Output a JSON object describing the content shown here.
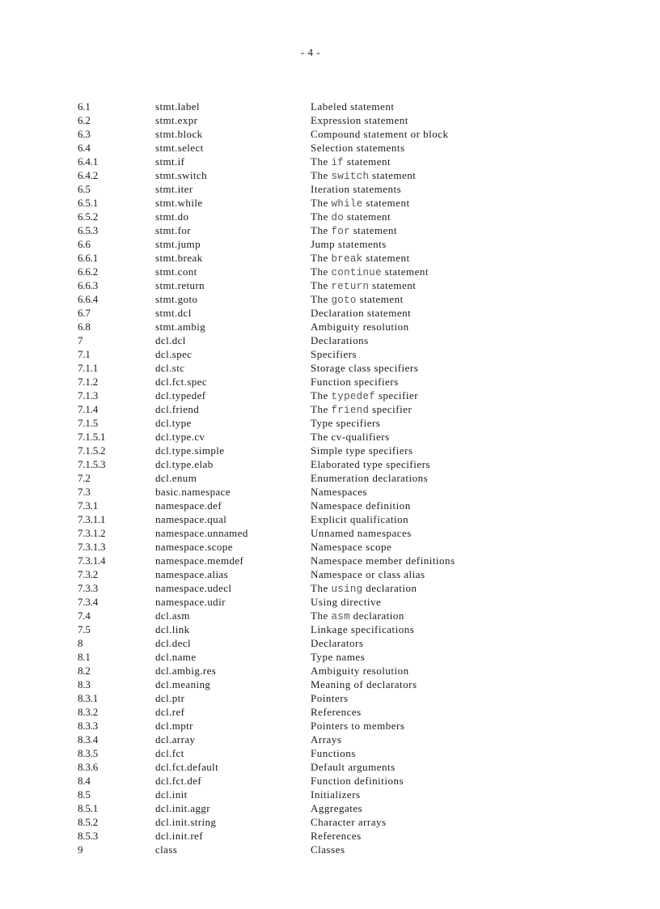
{
  "page": {
    "number": "- 4 -"
  },
  "entries": [
    {
      "num": "6.1",
      "label": "stmt.label",
      "title": [
        "Labeled statement"
      ]
    },
    {
      "num": "6.2",
      "label": "stmt.expr",
      "title": [
        "Expression statement"
      ]
    },
    {
      "num": "6.3",
      "label": "stmt.block",
      "title": [
        "Compound statement or block"
      ]
    },
    {
      "num": "6.4",
      "label": "stmt.select",
      "title": [
        "Selection statements"
      ]
    },
    {
      "num": "6.4.1",
      "label": "stmt.if",
      "title": [
        "The ",
        "if",
        " statement"
      ]
    },
    {
      "num": "6.4.2",
      "label": "stmt.switch",
      "title": [
        "The ",
        "switch",
        " statement"
      ]
    },
    {
      "num": "6.5",
      "label": "stmt.iter",
      "title": [
        "Iteration statements"
      ]
    },
    {
      "num": "6.5.1",
      "label": "stmt.while",
      "title": [
        "The ",
        "while",
        " statement"
      ]
    },
    {
      "num": "6.5.2",
      "label": "stmt.do",
      "title": [
        "The ",
        "do",
        " statement"
      ]
    },
    {
      "num": "6.5.3",
      "label": "stmt.for",
      "title": [
        "The ",
        "for",
        " statement"
      ]
    },
    {
      "num": "6.6",
      "label": "stmt.jump",
      "title": [
        "Jump statements"
      ]
    },
    {
      "num": "6.6.1",
      "label": "stmt.break",
      "title": [
        "The ",
        "break",
        " statement"
      ]
    },
    {
      "num": "6.6.2",
      "label": "stmt.cont",
      "title": [
        "The ",
        "continue",
        " statement"
      ]
    },
    {
      "num": "6.6.3",
      "label": "stmt.return",
      "title": [
        "The ",
        "return",
        " statement"
      ]
    },
    {
      "num": "6.6.4",
      "label": "stmt.goto",
      "title": [
        "The ",
        "goto",
        " statement"
      ]
    },
    {
      "num": "6.7",
      "label": "stmt.dcl",
      "title": [
        "Declaration statement"
      ]
    },
    {
      "num": "6.8",
      "label": "stmt.ambig",
      "title": [
        "Ambiguity resolution"
      ]
    },
    {
      "num": "7",
      "label": "dcl.dcl",
      "title": [
        "Declarations"
      ]
    },
    {
      "num": "7.1",
      "label": "dcl.spec",
      "title": [
        "Specifiers"
      ]
    },
    {
      "num": "7.1.1",
      "label": "dcl.stc",
      "title": [
        "Storage class specifiers"
      ]
    },
    {
      "num": "7.1.2",
      "label": "dcl.fct.spec",
      "title": [
        "Function specifiers"
      ]
    },
    {
      "num": "7.1.3",
      "label": "dcl.typedef",
      "title": [
        "The ",
        "typedef",
        " specifier"
      ]
    },
    {
      "num": "7.1.4",
      "label": "dcl.friend",
      "title": [
        "The ",
        "friend",
        " specifier"
      ]
    },
    {
      "num": "7.1.5",
      "label": "dcl.type",
      "title": [
        "Type specifiers"
      ]
    },
    {
      "num": "7.1.5.1",
      "label": "dcl.type.cv",
      "title": [
        "The cv-qualifiers"
      ]
    },
    {
      "num": "7.1.5.2",
      "label": "dcl.type.simple",
      "title": [
        "Simple type specifiers"
      ]
    },
    {
      "num": "7.1.5.3",
      "label": "dcl.type.elab",
      "title": [
        "Elaborated type specifiers"
      ]
    },
    {
      "num": "7.2",
      "label": "dcl.enum",
      "title": [
        "Enumeration declarations"
      ]
    },
    {
      "num": "7.3",
      "label": "basic.namespace",
      "title": [
        "Namespaces"
      ]
    },
    {
      "num": "7.3.1",
      "label": "namespace.def",
      "title": [
        "Namespace definition"
      ]
    },
    {
      "num": "7.3.1.1",
      "label": "namespace.qual",
      "title": [
        "Explicit qualification"
      ]
    },
    {
      "num": "7.3.1.2",
      "label": "namespace.unnamed",
      "title": [
        "Unnamed namespaces"
      ]
    },
    {
      "num": "7.3.1.3",
      "label": "namespace.scope",
      "title": [
        "Namespace scope"
      ]
    },
    {
      "num": "7.3.1.4",
      "label": "namespace.memdef",
      "title": [
        "Namespace member definitions"
      ]
    },
    {
      "num": "7.3.2",
      "label": "namespace.alias",
      "title": [
        "Namespace or class alias"
      ]
    },
    {
      "num": "7.3.3",
      "label": "namespace.udecl",
      "title": [
        "The ",
        "using",
        " declaration"
      ]
    },
    {
      "num": "7.3.4",
      "label": "namespace.udir",
      "title": [
        "Using directive"
      ]
    },
    {
      "num": "7.4",
      "label": "dcl.asm",
      "title": [
        "The ",
        "asm",
        " declaration"
      ]
    },
    {
      "num": "7.5",
      "label": "dcl.link",
      "title": [
        "Linkage specifications"
      ]
    },
    {
      "num": "8",
      "label": "dcl.decl",
      "title": [
        "Declarators"
      ]
    },
    {
      "num": "8.1",
      "label": "dcl.name",
      "title": [
        "Type names"
      ]
    },
    {
      "num": "8.2",
      "label": "dcl.ambig.res",
      "title": [
        "Ambiguity resolution"
      ]
    },
    {
      "num": "8.3",
      "label": "dcl.meaning",
      "title": [
        "Meaning of declarators"
      ]
    },
    {
      "num": "8.3.1",
      "label": "dcl.ptr",
      "title": [
        "Pointers"
      ]
    },
    {
      "num": "8.3.2",
      "label": "dcl.ref",
      "title": [
        "References"
      ]
    },
    {
      "num": "8.3.3",
      "label": "dcl.mptr",
      "title": [
        "Pointers to members"
      ]
    },
    {
      "num": "8.3.4",
      "label": "dcl.array",
      "title": [
        "Arrays"
      ]
    },
    {
      "num": "8.3.5",
      "label": "dcl.fct",
      "title": [
        "Functions"
      ]
    },
    {
      "num": "8.3.6",
      "label": "dcl.fct.default",
      "title": [
        "Default arguments"
      ]
    },
    {
      "num": "8.4",
      "label": "dcl.fct.def",
      "title": [
        "Function definitions"
      ]
    },
    {
      "num": "8.5",
      "label": "dcl.init",
      "title": [
        "Initializers"
      ]
    },
    {
      "num": "8.5.1",
      "label": "dcl.init.aggr",
      "title": [
        "Aggregates"
      ]
    },
    {
      "num": "8.5.2",
      "label": "dcl.init.string",
      "title": [
        "Character arrays"
      ]
    },
    {
      "num": "8.5.3",
      "label": "dcl.init.ref",
      "title": [
        "References"
      ]
    },
    {
      "num": "9",
      "label": "class",
      "title": [
        "Classes"
      ]
    }
  ]
}
